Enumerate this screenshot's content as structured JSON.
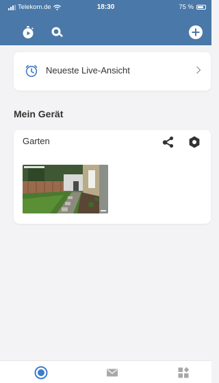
{
  "status_bar": {
    "carrier": "Telekom.de",
    "time": "18:30",
    "battery": "75 %",
    "battery_level": 0.75,
    "icons": [
      "signal-icon",
      "wifi-icon",
      "battery-icon"
    ]
  },
  "header": {
    "background": "#4a78a8",
    "icons": [
      "timer-icon",
      "search-icon",
      "add-icon"
    ]
  },
  "live_view": {
    "label": "Neueste Live-Ansicht",
    "icon": "clock-icon",
    "accent": "#3d7cc9"
  },
  "my_devices": {
    "title": "Mein Gerät",
    "devices": [
      {
        "name": "Garten",
        "icons": [
          "share-icon",
          "settings-icon"
        ],
        "thumbnail": "camera-thumbnail"
      }
    ]
  },
  "tab_bar": {
    "active_color": "#3d7cc9",
    "inactive_color": "#a8a8a8",
    "tabs": [
      {
        "icon": "home-camera-icon",
        "active": true
      },
      {
        "icon": "mail-icon",
        "active": false
      },
      {
        "icon": "grid-icon",
        "active": false
      }
    ]
  }
}
